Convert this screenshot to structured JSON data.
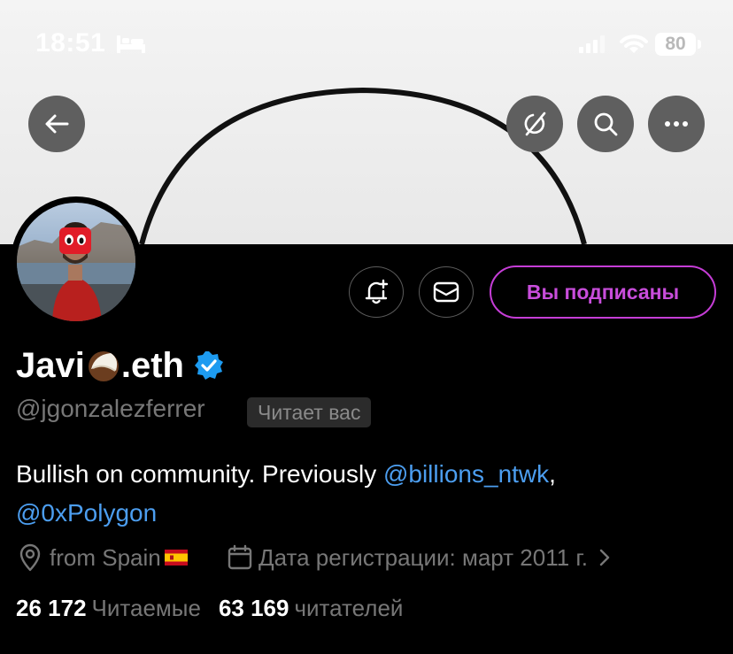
{
  "status_bar": {
    "time": "18:51",
    "battery": "80"
  },
  "profile": {
    "display_name_prefix": "Javi",
    "display_name_suffix": ".eth",
    "handle": "@jgonzalezferrer",
    "follows_you_badge": "Читает вас",
    "follow_button": "Вы подписаны",
    "bio_text": "Bullish on community. Previously ",
    "bio_mention_1": "@billions_ntwk",
    "bio_separator": ",",
    "bio_mention_2": "@0xPolygon",
    "location": "from Spain",
    "joined": "Дата регистрации: март 2011 г.",
    "following_count": "26 172",
    "following_label": "Читаемые",
    "followers_count": "63 169",
    "followers_label": "читателей"
  },
  "colors": {
    "accent_follow": "#c53dd6",
    "mention": "#4c9ef0",
    "verified": "#1d9bf0"
  },
  "icons": [
    "back-arrow-icon",
    "grok-icon",
    "search-icon",
    "more-icon",
    "notification-bell-icon",
    "message-icon",
    "verified-badge-icon",
    "location-pin-icon",
    "calendar-icon",
    "chevron-right-icon",
    "coconut-emoji-icon",
    "spain-flag-icon"
  ]
}
